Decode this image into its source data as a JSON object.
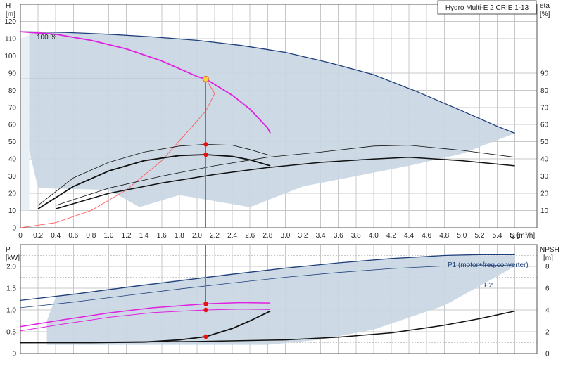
{
  "chart_data": [
    {
      "type": "line",
      "panel": "upper",
      "title": "Hydro Multi-E 2 CRIE 1-13",
      "left_axis": {
        "label_top": "H",
        "label_unit": "[m]",
        "ylim": [
          0,
          130
        ],
        "ticks": [
          0,
          10,
          20,
          30,
          40,
          50,
          60,
          70,
          80,
          90,
          100,
          110,
          120
        ]
      },
      "right_axis": {
        "label_top": "eta",
        "label_unit": "[%]",
        "ylim": [
          0,
          130
        ],
        "ticks": [
          10,
          20,
          30,
          40,
          50,
          60,
          70,
          80,
          90
        ]
      },
      "x_axis": {
        "label": "Q [m³/h]",
        "xlim": [
          0,
          5.85
        ],
        "ticks": [
          0,
          0.2,
          0.4,
          0.6,
          0.8,
          1.0,
          1.2,
          1.4,
          1.6,
          1.8,
          2.0,
          2.2,
          2.4,
          2.6,
          2.8,
          3.0,
          3.2,
          3.4,
          3.6,
          3.8,
          4.0,
          4.2,
          4.4,
          4.6,
          4.8,
          5.0,
          5.2,
          5.4,
          5.6
        ]
      },
      "grid": true,
      "annotation": "100 %",
      "range_region": {
        "upper": [
          [
            0.1,
            114
          ],
          [
            0.5,
            113.5
          ],
          [
            1.0,
            112.5
          ],
          [
            1.5,
            111
          ],
          [
            2.0,
            109
          ],
          [
            2.5,
            106
          ],
          [
            3.0,
            102
          ],
          [
            3.5,
            96
          ],
          [
            4.0,
            89
          ],
          [
            4.5,
            79
          ],
          [
            5.0,
            68
          ],
          [
            5.4,
            59
          ],
          [
            5.6,
            55
          ]
        ],
        "lower": [
          [
            5.6,
            55
          ],
          [
            5.0,
            43
          ],
          [
            4.4,
            36
          ],
          [
            3.8,
            30
          ],
          [
            3.2,
            24
          ],
          [
            2.6,
            12
          ],
          [
            1.8,
            19
          ],
          [
            1.35,
            12
          ],
          [
            1.0,
            22
          ],
          [
            0.2,
            23
          ],
          [
            0.1,
            45
          ],
          [
            0.1,
            114
          ]
        ]
      },
      "series": [
        {
          "role": "max-curve",
          "color": "#1f3f7a",
          "points": [
            [
              0,
              114
            ],
            [
              0.5,
              113.6
            ],
            [
              1.0,
              112.5
            ],
            [
              1.5,
              111
            ],
            [
              2.0,
              109
            ],
            [
              2.5,
              106
            ],
            [
              3.0,
              102
            ],
            [
              3.5,
              96
            ],
            [
              4.0,
              89
            ],
            [
              4.5,
              79
            ],
            [
              5.0,
              68
            ],
            [
              5.4,
              59
            ],
            [
              5.6,
              55
            ]
          ]
        },
        {
          "role": "duty-curve",
          "color": "#e020e0",
          "points": [
            [
              0,
              114
            ],
            [
              0.4,
              112.5
            ],
            [
              0.8,
              109
            ],
            [
              1.2,
              104
            ],
            [
              1.6,
              97
            ],
            [
              2.0,
              88
            ],
            [
              2.1,
              86.5
            ],
            [
              2.4,
              77
            ],
            [
              2.6,
              69
            ],
            [
              2.8,
              58
            ],
            [
              2.83,
              55
            ]
          ]
        },
        {
          "role": "system-curve",
          "color": "#ff5050",
          "points": [
            [
              0,
              0
            ],
            [
              0.4,
              3
            ],
            [
              0.8,
              10
            ],
            [
              1.2,
              22
            ],
            [
              1.6,
              39
            ],
            [
              2.0,
              62
            ],
            [
              2.1,
              68
            ],
            [
              2.2,
              78
            ],
            [
              2.1,
              86.5
            ]
          ]
        },
        {
          "role": "eta-max",
          "color": "#111111",
          "points": [
            [
              0.4,
              11
            ],
            [
              1.0,
              20
            ],
            [
              1.6,
              26
            ],
            [
              2.2,
              31
            ],
            [
              2.8,
              35
            ],
            [
              3.4,
              38
            ],
            [
              4.0,
              40
            ],
            [
              4.4,
              41
            ],
            [
              5.0,
              39
            ],
            [
              5.6,
              36
            ]
          ]
        },
        {
          "role": "eta-max-thin",
          "color": "#111111",
          "points": [
            [
              0.4,
              13
            ],
            [
              1.0,
              23
            ],
            [
              1.6,
              30
            ],
            [
              2.2,
              36
            ],
            [
              2.8,
              41
            ],
            [
              3.4,
              44
            ],
            [
              4.0,
              47.5
            ],
            [
              4.4,
              48
            ],
            [
              5.0,
              45
            ],
            [
              5.6,
              41
            ]
          ]
        },
        {
          "role": "eta-duty",
          "color": "#111111",
          "points": [
            [
              0.2,
              11
            ],
            [
              0.6,
              24
            ],
            [
              1.0,
              33
            ],
            [
              1.4,
              39
            ],
            [
              1.8,
              42
            ],
            [
              2.1,
              42.5
            ],
            [
              2.4,
              41.5
            ],
            [
              2.6,
              39.5
            ],
            [
              2.83,
              36
            ]
          ]
        },
        {
          "role": "eta-duty-thin",
          "color": "#111111",
          "points": [
            [
              0.2,
              13
            ],
            [
              0.6,
              29
            ],
            [
              1.0,
              38
            ],
            [
              1.4,
              44
            ],
            [
              1.8,
              47.5
            ],
            [
              2.1,
              48.5
            ],
            [
              2.4,
              48
            ],
            [
              2.6,
              45.5
            ],
            [
              2.83,
              42
            ]
          ]
        }
      ],
      "duty_point": {
        "q": 2.1,
        "h": 86.5
      },
      "markers": [
        [
          2.1,
          48.5
        ],
        [
          2.1,
          42.5
        ]
      ]
    },
    {
      "type": "line",
      "panel": "lower",
      "left_axis": {
        "label_top": "P",
        "label_unit": "[kW]",
        "ylim": [
          0,
          2.5
        ],
        "ticks": [
          "0",
          "0.5",
          "1.0",
          "1.5",
          "2.0"
        ]
      },
      "right_axis": {
        "label_top": "NPSH",
        "label_unit": "[m]",
        "ylim": [
          0,
          10
        ],
        "ticks": [
          "0",
          "2",
          "4",
          "6",
          "8"
        ]
      },
      "x_axis": {
        "xlim": [
          0,
          5.85
        ]
      },
      "grid": true,
      "labels": [
        "P1 (motor+freq.converter)",
        "P2"
      ],
      "range_region": {
        "upper": [
          [
            0.4,
            1.3
          ],
          [
            1.0,
            1.48
          ],
          [
            1.6,
            1.64
          ],
          [
            2.2,
            1.79
          ],
          [
            2.8,
            1.92
          ],
          [
            3.4,
            2.04
          ],
          [
            4.0,
            2.14
          ],
          [
            4.6,
            2.22
          ],
          [
            5.0,
            2.25
          ],
          [
            5.6,
            2.25
          ]
        ],
        "lower": [
          [
            5.6,
            2.0
          ],
          [
            4.8,
            1.1
          ],
          [
            4.0,
            0.55
          ],
          [
            3.4,
            0.32
          ],
          [
            2.8,
            0.2
          ],
          [
            0.3,
            0.2
          ],
          [
            0.3,
            0.75
          ],
          [
            0.4,
            1.3
          ]
        ]
      },
      "series": [
        {
          "role": "p1-max",
          "color": "#1f3f7a",
          "points": [
            [
              0,
              1.22
            ],
            [
              0.6,
              1.36
            ],
            [
              1.2,
              1.52
            ],
            [
              1.8,
              1.67
            ],
            [
              2.4,
              1.82
            ],
            [
              3.0,
              1.96
            ],
            [
              3.6,
              2.08
            ],
            [
              4.2,
              2.18
            ],
            [
              4.8,
              2.25
            ],
            [
              5.2,
              2.27
            ],
            [
              5.6,
              2.27
            ]
          ]
        },
        {
          "role": "p2-max",
          "color": "#1f3f7a",
          "points": [
            [
              0,
              1.05
            ],
            [
              0.6,
              1.18
            ],
            [
              1.2,
              1.33
            ],
            [
              1.8,
              1.48
            ],
            [
              2.4,
              1.62
            ],
            [
              3.0,
              1.75
            ],
            [
              3.6,
              1.86
            ],
            [
              4.2,
              1.95
            ],
            [
              4.8,
              2.01
            ],
            [
              5.6,
              2.03
            ]
          ]
        },
        {
          "role": "p1-duty",
          "color": "#e020e0",
          "points": [
            [
              0,
              0.62
            ],
            [
              0.5,
              0.78
            ],
            [
              1.0,
              0.93
            ],
            [
              1.5,
              1.05
            ],
            [
              2.1,
              1.14
            ],
            [
              2.5,
              1.17
            ],
            [
              2.83,
              1.16
            ]
          ]
        },
        {
          "role": "p2-duty",
          "color": "#e020e0",
          "points": [
            [
              0,
              0.52
            ],
            [
              0.5,
              0.68
            ],
            [
              1.0,
              0.83
            ],
            [
              1.5,
              0.94
            ],
            [
              2.1,
              1.0
            ],
            [
              2.5,
              1.02
            ],
            [
              2.83,
              1.01
            ]
          ]
        },
        {
          "role": "npsh-max",
          "color": "#111111",
          "axis": "right",
          "points": [
            [
              0,
              1.0
            ],
            [
              1.0,
              1.05
            ],
            [
              2.0,
              1.1
            ],
            [
              3.0,
              1.25
            ],
            [
              3.6,
              1.5
            ],
            [
              4.2,
              1.9
            ],
            [
              4.8,
              2.6
            ],
            [
              5.2,
              3.2
            ],
            [
              5.6,
              3.9
            ]
          ]
        },
        {
          "role": "npsh-duty",
          "color": "#111111",
          "axis": "right",
          "points": [
            [
              0,
              1.0
            ],
            [
              0.8,
              1.0
            ],
            [
              1.4,
              1.05
            ],
            [
              1.8,
              1.25
            ],
            [
              2.1,
              1.55
            ],
            [
              2.4,
              2.3
            ],
            [
              2.6,
              3.0
            ],
            [
              2.83,
              3.9
            ]
          ]
        }
      ],
      "markers_left": [
        [
          2.1,
          1.14
        ],
        [
          2.1,
          1.0
        ]
      ],
      "markers_right": [
        [
          2.1,
          1.55
        ]
      ]
    }
  ]
}
